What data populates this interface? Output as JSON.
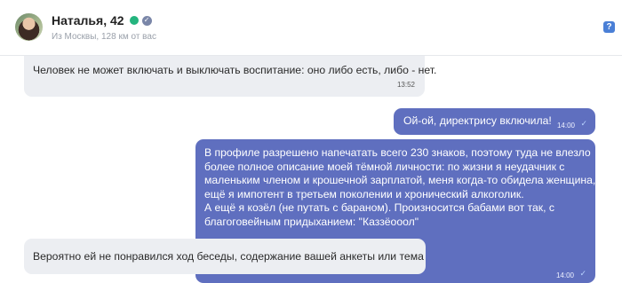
{
  "header": {
    "name": "Наталья, 42",
    "location": "Из Москвы, 128 км от вас",
    "verified_icon": "✓",
    "help_label": "?"
  },
  "messages": [
    {
      "direction": "incoming",
      "text": "Человек не может включать и выключать воспитание: оно либо есть, либо - нет.",
      "time": "13:52"
    },
    {
      "direction": "outgoing",
      "text": "Ой-ой, директрису включила!",
      "time": "14:00",
      "read": true
    },
    {
      "direction": "outgoing",
      "lines": [
        "В профиле разрешено напечатать всего 230 знаков, поэтому туда не влезло",
        "более полное описание моей тёмной личности: по жизни я неудачник с",
        "маленьким членом и крошечной зарплатой, меня когда-то обидела женщина, а",
        "ещё я импотент в третьем поколении и хронический алкоголик.",
        "А ещё я козёл (не путать с бараном). Произносится бабами вот так, с",
        "благоговейным придыханием: \"Каззёооол\""
      ],
      "time": "14:00",
      "read": true
    },
    {
      "direction": "incoming",
      "text": "Вероятно ей не понравился ход беседы, содержание вашей анкеты или тема"
    }
  ],
  "icons": {
    "check": "✓"
  },
  "colors": {
    "online": "#24b47e",
    "outgoing_bubble": "#5f6fbf",
    "incoming_bubble": "#eceef2",
    "accent": "#4a7fd6"
  }
}
